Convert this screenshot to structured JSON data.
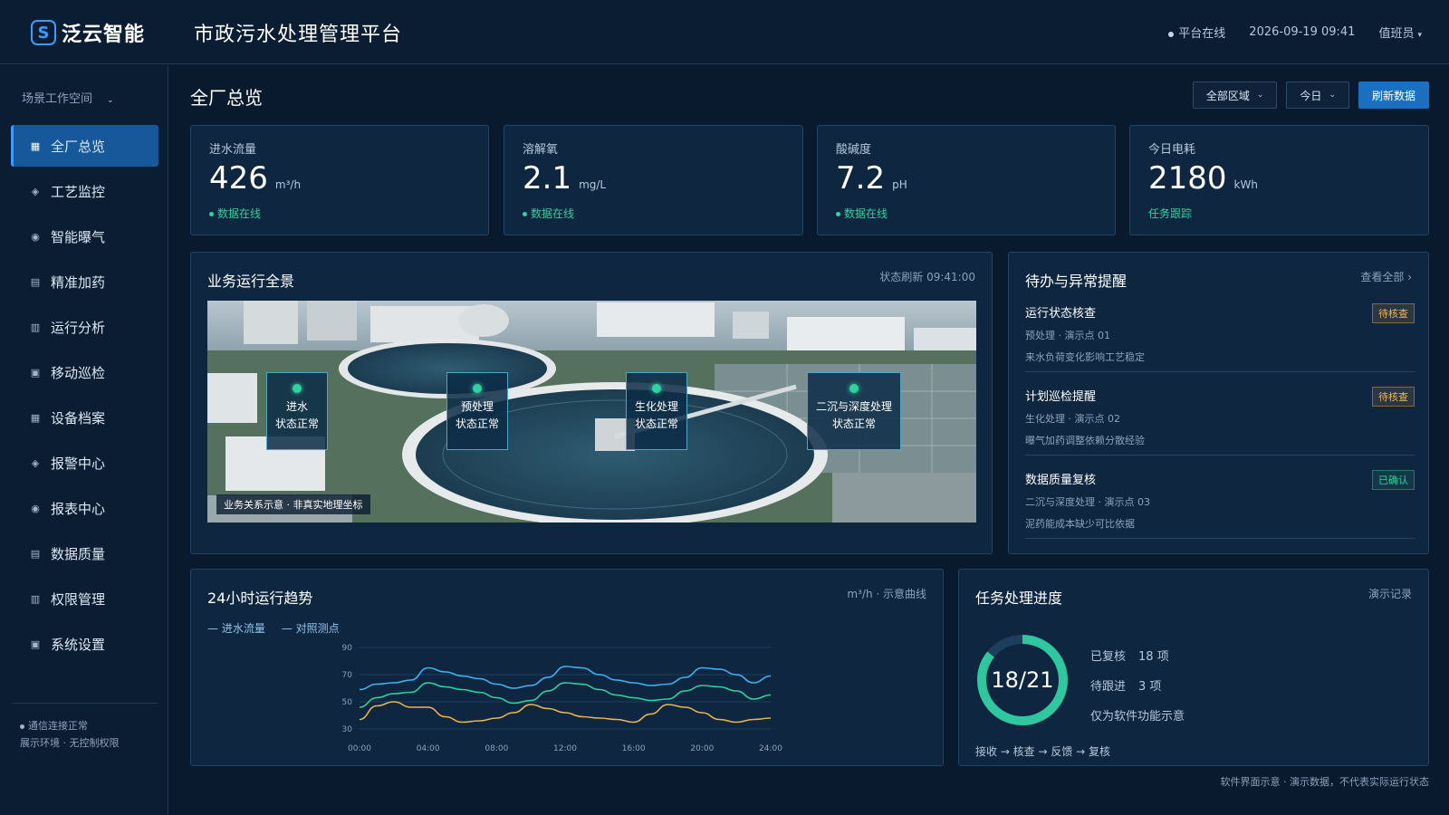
{
  "header": {
    "logo_mark": "S",
    "brand": "泛云智能",
    "title": "市政污水处理管理平台",
    "status": "平台在线",
    "datetime": "2026-09-19 09:41",
    "user": "值班员"
  },
  "sidebar": {
    "workspace": "场景工作空间",
    "items": [
      {
        "label": "全厂总览",
        "icon": "grid-icon",
        "glyph": "▦",
        "active": true
      },
      {
        "label": "工艺监控",
        "icon": "diamond-icon",
        "glyph": "◈"
      },
      {
        "label": "智能曝气",
        "icon": "target-icon",
        "glyph": "◉"
      },
      {
        "label": "精准加药",
        "icon": "list-icon",
        "glyph": "▤"
      },
      {
        "label": "运行分析",
        "icon": "columns-icon",
        "glyph": "▥"
      },
      {
        "label": "移动巡检",
        "icon": "square-dot-icon",
        "glyph": "▣"
      },
      {
        "label": "设备档案",
        "icon": "grid-icon",
        "glyph": "▦"
      },
      {
        "label": "报警中心",
        "icon": "diamond-icon",
        "glyph": "◈"
      },
      {
        "label": "报表中心",
        "icon": "target-icon",
        "glyph": "◉"
      },
      {
        "label": "数据质量",
        "icon": "list-icon",
        "glyph": "▤"
      },
      {
        "label": "权限管理",
        "icon": "columns-icon",
        "glyph": "▥"
      },
      {
        "label": "系统设置",
        "icon": "square-dot-icon",
        "glyph": "▣"
      }
    ],
    "footer_status": "通信连接正常",
    "footer_env": "展示环境 · 无控制权限"
  },
  "page": {
    "title": "全厂总览",
    "filter_area": "全部区域",
    "filter_date": "今日",
    "refresh": "刷新数据"
  },
  "kpis": [
    {
      "label": "进水流量",
      "value": "426",
      "unit": "m³/h",
      "status": "数据在线",
      "dot": true
    },
    {
      "label": "溶解氧",
      "value": "2.1",
      "unit": "mg/L",
      "status": "数据在线",
      "dot": true
    },
    {
      "label": "酸碱度",
      "value": "7.2",
      "unit": "pH",
      "status": "数据在线",
      "dot": true
    },
    {
      "label": "今日电耗",
      "value": "2180",
      "unit": "kWh",
      "status": "任务跟踪",
      "dot": false
    }
  ],
  "panorama": {
    "title": "业务运行全景",
    "refresh_time": "状态刷新 09:41:00",
    "caption": "业务关系示意 · 非真实地理坐标",
    "stages": [
      {
        "name": "进水",
        "status": "状态正常"
      },
      {
        "name": "预处理",
        "status": "状态正常"
      },
      {
        "name": "生化处理",
        "status": "状态正常"
      },
      {
        "name": "二沉与深度处理",
        "status": "状态正常"
      }
    ]
  },
  "alerts": {
    "title": "待办与异常提醒",
    "view_all": "查看全部 ›",
    "items": [
      {
        "title": "运行状态核查",
        "sub": "预处理 · 演示点 01",
        "desc": "来水负荷变化影响工艺稳定",
        "badge": "待核查",
        "state": "pending"
      },
      {
        "title": "计划巡检提醒",
        "sub": "生化处理 · 演示点 02",
        "desc": "曝气加药调整依赖分散经验",
        "badge": "待核查",
        "state": "pending"
      },
      {
        "title": "数据质量复核",
        "sub": "二沉与深度处理 · 演示点 03",
        "desc": "泥药能成本缺少可比依据",
        "badge": "已确认",
        "state": "confirmed"
      }
    ]
  },
  "trend": {
    "title": "24小时运行趋势",
    "meta": "m³/h · 示意曲线",
    "legend": [
      "进水流量",
      "对照测点"
    ]
  },
  "chart_data": {
    "type": "line",
    "title": "24小时运行趋势",
    "x": [
      "00:00",
      "01:00",
      "02:00",
      "03:00",
      "04:00",
      "05:00",
      "06:00",
      "07:00",
      "08:00",
      "09:00",
      "10:00",
      "11:00",
      "12:00",
      "13:00",
      "14:00",
      "15:00",
      "16:00",
      "17:00",
      "18:00",
      "19:00",
      "20:00",
      "21:00",
      "22:00",
      "23:00",
      "24:00"
    ],
    "xticks": [
      "00:00",
      "04:00",
      "08:00",
      "12:00",
      "16:00",
      "20:00",
      "24:00"
    ],
    "ylim": [
      30,
      90
    ],
    "yticks": [
      30,
      50,
      70,
      90
    ],
    "grid": true,
    "series": [
      {
        "name": "进水流量",
        "color": "#3fb2f5",
        "values": [
          59,
          63,
          64,
          66,
          75,
          72,
          69,
          67,
          63,
          60,
          62,
          68,
          76,
          75,
          70,
          66,
          64,
          62,
          63,
          68,
          75,
          74,
          70,
          64,
          69
        ]
      },
      {
        "name": "对照测点",
        "color": "#2fd3a0",
        "values": [
          46,
          53,
          56,
          57,
          64,
          61,
          59,
          57,
          53,
          49,
          51,
          58,
          64,
          63,
          59,
          55,
          53,
          51,
          52,
          58,
          62,
          61,
          58,
          52,
          55
        ]
      },
      {
        "color": "#e9b54f",
        "values": [
          37,
          47,
          50,
          46,
          46,
          39,
          35,
          36,
          38,
          42,
          48,
          45,
          42,
          39,
          38,
          37,
          35,
          41,
          48,
          46,
          42,
          37,
          35,
          37,
          38
        ]
      }
    ]
  },
  "progress": {
    "title": "任务处理进度",
    "meta": "演示记录",
    "done": 18,
    "total": 21,
    "ratio_label": "18/21",
    "reviewed_label": "已复核",
    "reviewed_value": "18 项",
    "followup_label": "待跟进",
    "followup_value": "3 项",
    "note": "仅为软件功能示意",
    "flow": "接收 → 核查 → 反馈 → 复核"
  },
  "footer": {
    "note": "软件界面示意 · 演示数据，不代表实际运行状态"
  }
}
